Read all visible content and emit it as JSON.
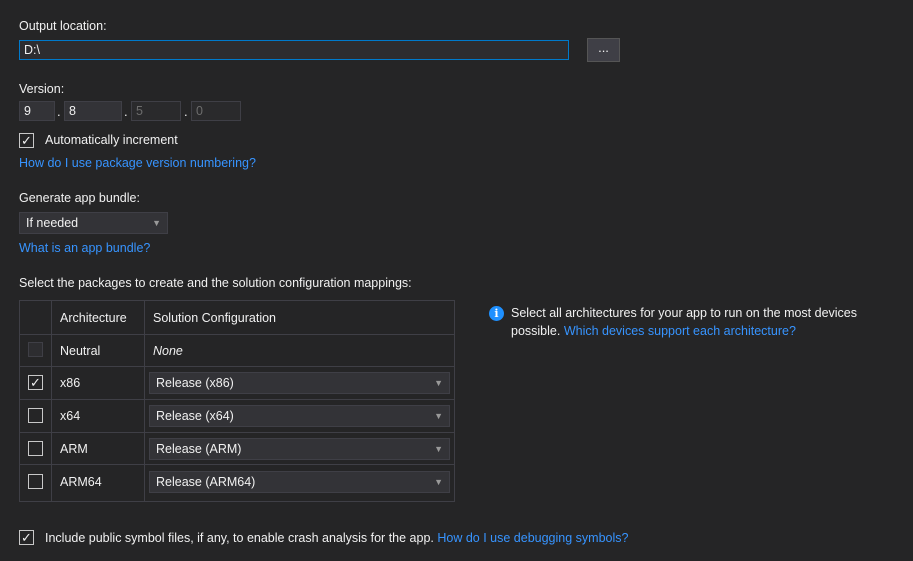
{
  "output": {
    "label": "Output location:",
    "value": "D:\\",
    "browse_label": "..."
  },
  "version": {
    "label": "Version:",
    "major": "9",
    "minor": "8",
    "build": "5",
    "revision": "0",
    "separator": "."
  },
  "auto_increment": {
    "checked": true,
    "label": "Automatically increment"
  },
  "version_help_link": "How do I use package version numbering?",
  "bundle": {
    "label": "Generate app bundle:",
    "selected": "If needed",
    "help_link": "What is an app bundle?"
  },
  "packages": {
    "label": "Select the packages to create and the solution configuration mappings:",
    "columns": [
      "Architecture",
      "Solution Configuration"
    ],
    "rows": [
      {
        "arch": "Neutral",
        "config": "None",
        "checked": false,
        "disabled": true
      },
      {
        "arch": "x86",
        "config": "Release (x86)",
        "checked": true,
        "disabled": false
      },
      {
        "arch": "x64",
        "config": "Release (x64)",
        "checked": false,
        "disabled": false
      },
      {
        "arch": "ARM",
        "config": "Release (ARM)",
        "checked": false,
        "disabled": false
      },
      {
        "arch": "ARM64",
        "config": "Release (ARM64)",
        "checked": false,
        "disabled": false
      }
    ]
  },
  "info": {
    "icon": "info-icon",
    "text_line1": "Select all architectures for your app to run on the most devices",
    "text_line2": "possible.",
    "link": "Which devices support each architecture?"
  },
  "symbols": {
    "checked": true,
    "label": "Include public symbol files, if any, to enable crash analysis for the app.",
    "link": "How do I use debugging symbols?"
  },
  "colors": {
    "background": "#252526",
    "accent": "#007acc",
    "link": "#3794ff",
    "text": "#f1f1f1"
  }
}
